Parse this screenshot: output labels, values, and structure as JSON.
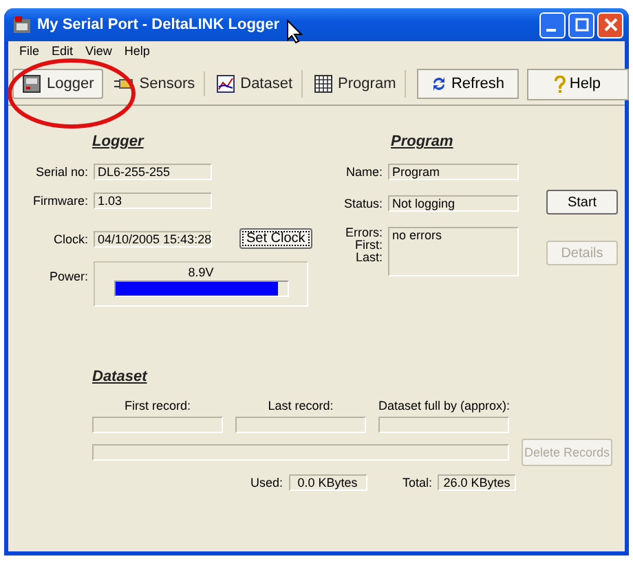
{
  "window": {
    "title": "My Serial Port - DeltaLINK Logger"
  },
  "menu": [
    "File",
    "Edit",
    "View",
    "Help"
  ],
  "tabs": [
    {
      "label": "Logger",
      "selected": true
    },
    {
      "label": "Sensors",
      "selected": false
    },
    {
      "label": "Dataset",
      "selected": false
    },
    {
      "label": "Program",
      "selected": false
    }
  ],
  "toolbar_buttons": [
    "Refresh",
    "Help"
  ],
  "logger": {
    "heading": "Logger",
    "fields": [
      {
        "label": "Serial no:",
        "value": "DL6-255-255"
      },
      {
        "label": "Firmware:",
        "value": "1.03"
      }
    ],
    "clock": {
      "label": "Clock:",
      "value": "04/10/2005 15:43:28",
      "button": "Set Clock"
    },
    "power": {
      "label": "Power:",
      "reading": "8.9V",
      "level": 0.95
    }
  },
  "program": {
    "heading": "Program",
    "name": {
      "label": "Name:",
      "value": "Program"
    },
    "status": {
      "label": "Status:",
      "value": "Not logging"
    },
    "start_button": {
      "label": "Start",
      "disabled": false
    },
    "errors": {
      "labels": [
        "Errors:",
        "First:",
        "Last:"
      ],
      "value": "no errors"
    },
    "details_button": {
      "label": "Details",
      "disabled": true
    }
  },
  "dataset": {
    "heading": "Dataset",
    "columns": [
      "First record:",
      "Last record:",
      "Dataset full by (approx):"
    ],
    "delete_button": {
      "label": "Delete Records",
      "disabled": true
    },
    "used": {
      "label": "Used:",
      "value": "0.0 KBytes"
    },
    "total": {
      "label": "Total:",
      "value": "26.0 KBytes"
    }
  }
}
